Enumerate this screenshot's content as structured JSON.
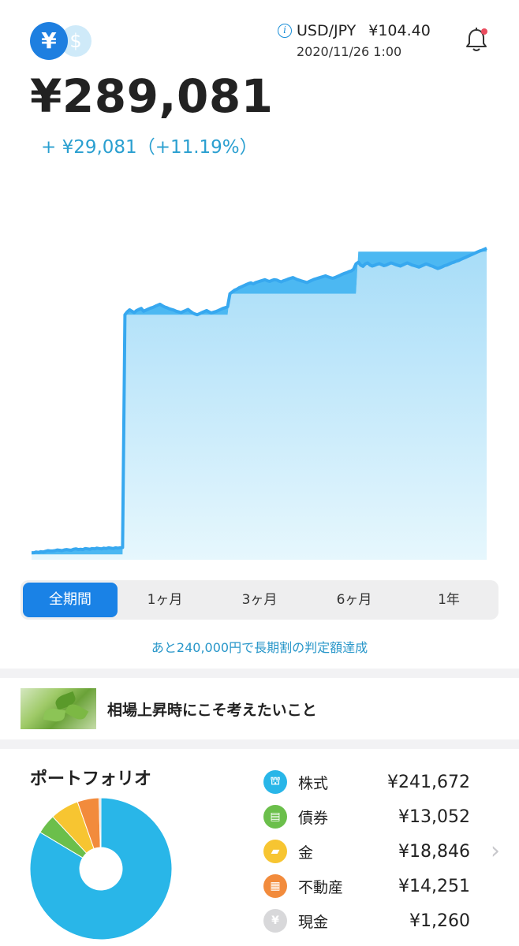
{
  "header": {
    "currency_yen": "¥",
    "currency_usd": "$",
    "fx_pair": "USD/JPY",
    "fx_rate": "¥104.40",
    "fx_time": "2020/11/26 1:00",
    "info_icon": "info-icon",
    "bell_icon": "bell-icon",
    "has_notification": true
  },
  "summary": {
    "total": "¥289,081",
    "gain": "+ ¥29,081（+11.19%）"
  },
  "chart_data": {
    "type": "area",
    "title": "",
    "xlabel": "",
    "ylabel": "",
    "grid": false,
    "ylim": [
      0,
      100
    ],
    "series": [
      {
        "values": [
          1.5,
          1.5,
          1.5,
          1.5,
          1.5,
          1.5,
          1.5,
          1.5,
          1.5,
          1.5,
          1.5,
          1.5,
          1.5,
          1.5,
          1.5,
          1.5,
          1.5,
          1.5,
          1.5,
          1.5,
          1.5,
          1.5,
          1.5,
          1.5,
          1.5,
          1.5,
          1.5,
          1.5,
          1.5,
          1.5,
          1.5,
          1.5,
          1.5,
          1.5,
          1.5,
          1.5,
          1.5,
          1.5,
          1.5,
          1.5,
          70,
          70,
          70,
          70,
          70,
          70,
          70,
          70,
          70,
          70,
          70,
          70,
          70,
          70,
          70,
          70,
          70,
          70,
          70,
          70,
          70,
          70,
          70,
          70,
          70,
          70,
          70,
          70,
          70,
          70,
          70,
          70,
          70,
          70,
          70,
          70,
          70,
          70,
          70,
          70,
          70,
          70,
          70,
          70,
          70,
          76,
          76,
          76,
          76,
          76,
          76,
          76,
          76,
          76,
          76,
          76,
          76,
          76,
          76,
          76,
          76,
          76,
          76,
          76,
          76,
          76,
          76,
          76,
          76,
          76,
          76,
          76,
          76,
          76,
          76,
          76,
          76,
          76,
          76,
          76,
          76,
          76,
          76,
          76,
          76,
          76,
          76,
          76,
          76,
          76,
          76,
          76,
          76,
          76,
          76,
          76,
          76,
          76,
          76,
          76,
          88,
          88,
          88,
          88,
          88,
          88,
          88,
          88,
          88,
          88,
          88,
          88,
          88,
          88,
          88,
          88,
          88,
          88,
          88,
          88,
          88,
          88,
          88,
          88,
          88,
          88,
          88,
          88,
          88,
          88,
          88,
          88,
          88,
          88,
          88,
          88,
          88,
          88,
          88,
          88,
          88,
          88,
          88,
          88,
          88,
          88,
          88,
          88,
          88,
          88,
          88,
          88,
          88,
          88,
          88,
          88,
          88,
          88,
          88,
          88,
          88,
          88,
          88,
          88,
          88,
          88,
          88,
          88,
          88,
          88,
          88,
          88,
          88,
          88,
          88,
          88,
          88,
          88,
          88,
          88,
          88,
          88,
          88,
          88,
          88,
          88
        ],
        "color": "#a5dcf8"
      },
      {
        "values": [
          2,
          2,
          2.2,
          2.1,
          2.3,
          2.2,
          2.4,
          2.6,
          2.5,
          2.5,
          2.6,
          2.8,
          2.7,
          2.6,
          2.8,
          2.9,
          2.8,
          2.7,
          3.0,
          3.1,
          2.9,
          3.0,
          2.9,
          3.2,
          3.1,
          3.0,
          3.2,
          3.1,
          3.3,
          3.2,
          3.1,
          3.3,
          3.2,
          3.4,
          3.3,
          3.2,
          3.4,
          3.3,
          3.4,
          3.5,
          70,
          70.8,
          71.4,
          71.0,
          70.6,
          71.2,
          71.5,
          71.8,
          71.0,
          71.3,
          71.6,
          71.9,
          72.1,
          72.4,
          72.7,
          73.0,
          72.6,
          72.2,
          72.0,
          71.7,
          71.5,
          71.3,
          71.0,
          70.8,
          70.6,
          70.9,
          71.2,
          71.5,
          71.0,
          70.5,
          70.2,
          70.0,
          70.3,
          70.6,
          70.9,
          71.2,
          70.8,
          70.5,
          70.7,
          70.9,
          71.2,
          71.5,
          71.8,
          72.0,
          72.3,
          76,
          76.5,
          77,
          77.3,
          77.7,
          78,
          78.3,
          78.6,
          78.9,
          79.1,
          78.8,
          79.2,
          79.4,
          79.6,
          79.8,
          80,
          79.7,
          79.5,
          79.8,
          80,
          79.9,
          79.6,
          79.4,
          79.7,
          79.9,
          80.2,
          80.4,
          80.6,
          80.3,
          80.0,
          79.8,
          79.6,
          79.4,
          79.2,
          79.5,
          79.8,
          80.1,
          80.3,
          80.5,
          80.7,
          80.9,
          81.1,
          80.8,
          80.6,
          80.4,
          80.6,
          80.9,
          81.2,
          81.5,
          81.8,
          82,
          82.3,
          82.5,
          83,
          84.5,
          85,
          84.2,
          83.8,
          84.5,
          84.8,
          84.2,
          83.9,
          84.1,
          84.4,
          84.6,
          84.3,
          84.0,
          84.2,
          84.5,
          84.8,
          84.6,
          84.3,
          84.1,
          83.9,
          84.2,
          84.5,
          84.8,
          84.5,
          84.2,
          84.0,
          83.8,
          83.6,
          83.9,
          84.2,
          84.5,
          84.3,
          84.0,
          83.8,
          83.5,
          83.2,
          83.4,
          83.7,
          84.0,
          84.2,
          84.5,
          84.8,
          85.0,
          85.3,
          85.5,
          85.8,
          86.1,
          86.4,
          86.7,
          87,
          87.3,
          87.6,
          87.9,
          88.2,
          88.4,
          88.7,
          89
        ]
      }
    ]
  },
  "periods": {
    "items": [
      "全期間",
      "1ヶ月",
      "3ヶ月",
      "6ヶ月",
      "1年"
    ],
    "active_index": 0
  },
  "notice": "あと240,000円で長期割の判定額達成",
  "article": {
    "title": "相場上昇時にこそ考えたいこと",
    "thumb_icon": "leaf-thumbnail"
  },
  "portfolio": {
    "title": "ポートフォリオ",
    "items": [
      {
        "label": "株式",
        "value": "¥241,672",
        "amount": 241672,
        "color": "#29b6e8",
        "icon": "bank-icon"
      },
      {
        "label": "債券",
        "value": "¥13,052",
        "amount": 13052,
        "color": "#6bbf4b",
        "icon": "bond-icon"
      },
      {
        "label": "金",
        "value": "¥18,846",
        "amount": 18846,
        "color": "#f7c531",
        "icon": "gold-bar-icon"
      },
      {
        "label": "不動産",
        "value": "¥14,251",
        "amount": 14251,
        "color": "#f28b3c",
        "icon": "building-icon"
      },
      {
        "label": "現金",
        "value": "¥1,260",
        "amount": 1260,
        "color": "#d8d8da",
        "icon": "cash-icon"
      }
    ],
    "next_icon": "chevron-right-icon"
  }
}
